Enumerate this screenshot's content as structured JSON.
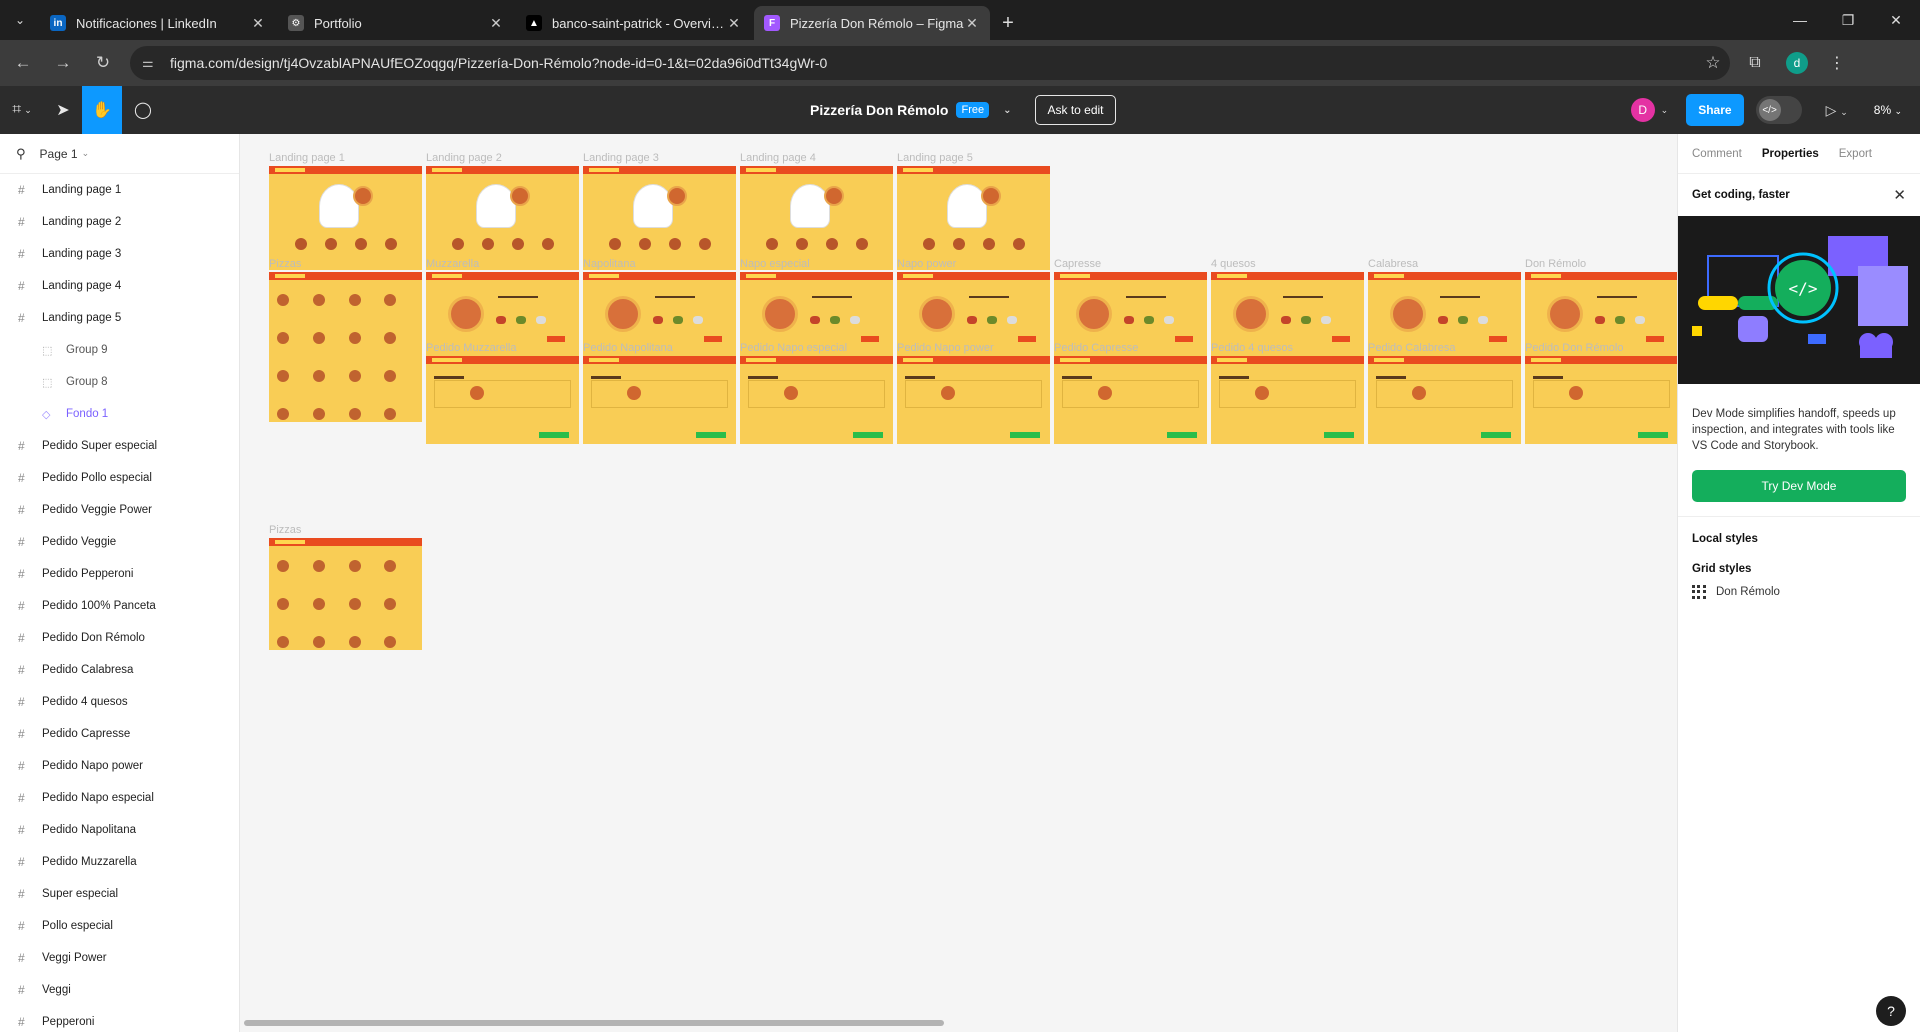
{
  "browser": {
    "tabs": [
      {
        "title": "Notificaciones | LinkedIn",
        "icon": "linkedin-icon",
        "color": "#0a66c2",
        "glyph": "in"
      },
      {
        "title": "Portfolio",
        "icon": "globe-icon",
        "color": "#555555",
        "glyph": "⚙"
      },
      {
        "title": "banco-saint-patrick - Overview",
        "icon": "vercel-icon",
        "color": "#000000",
        "glyph": "▲"
      },
      {
        "title": "Pizzería Don Rémolo – Figma",
        "icon": "figma-icon",
        "color": "#a259ff",
        "glyph": "F"
      }
    ],
    "url": "figma.com/design/tj4OvzablAPNAUfEOZoqgq/Pizzería-Don-Rémolo?node-id=0-1&t=02da96i0dTt34gWr-0",
    "profile_initial": "d"
  },
  "toolbar": {
    "file_name": "Pizzería Don Rémolo",
    "plan_badge": "Free",
    "ask_to_edit": "Ask to edit",
    "avatar_initial": "D",
    "share_label": "Share",
    "zoom": "8%"
  },
  "layers": {
    "page": "Page 1",
    "items": [
      {
        "label": "Landing page 1",
        "kind": "frame"
      },
      {
        "label": "Landing page 2",
        "kind": "frame"
      },
      {
        "label": "Landing page 3",
        "kind": "frame"
      },
      {
        "label": "Landing page 4",
        "kind": "frame"
      },
      {
        "label": "Landing page 5",
        "kind": "frame"
      },
      {
        "label": "Group 9",
        "kind": "group"
      },
      {
        "label": "Group 8",
        "kind": "group"
      },
      {
        "label": "Fondo 1",
        "kind": "component"
      },
      {
        "label": "Pedido Super especial",
        "kind": "frame"
      },
      {
        "label": "Pedido Pollo especial",
        "kind": "frame"
      },
      {
        "label": "Pedido Veggie Power",
        "kind": "frame"
      },
      {
        "label": "Pedido Veggie",
        "kind": "frame"
      },
      {
        "label": "Pedido Pepperoni",
        "kind": "frame"
      },
      {
        "label": "Pedido 100% Panceta",
        "kind": "frame"
      },
      {
        "label": "Pedido Don Rémolo",
        "kind": "frame"
      },
      {
        "label": "Pedido Calabresa",
        "kind": "frame"
      },
      {
        "label": "Pedido 4 quesos",
        "kind": "frame"
      },
      {
        "label": "Pedido Capresse",
        "kind": "frame"
      },
      {
        "label": "Pedido Napo power",
        "kind": "frame"
      },
      {
        "label": "Pedido Napo especial",
        "kind": "frame"
      },
      {
        "label": "Pedido Napolitana",
        "kind": "frame"
      },
      {
        "label": "Pedido Muzzarella",
        "kind": "frame"
      },
      {
        "label": "Super especial",
        "kind": "frame"
      },
      {
        "label": "Pollo especial",
        "kind": "frame"
      },
      {
        "label": "Veggi Power",
        "kind": "frame"
      },
      {
        "label": "Veggi",
        "kind": "frame"
      },
      {
        "label": "Pepperoni",
        "kind": "frame"
      }
    ]
  },
  "canvas": {
    "row1": [
      "Landing page 1",
      "Landing page 2",
      "Landing page 3",
      "Landing page 4",
      "Landing page 5"
    ],
    "row2": [
      "Pizzas",
      "Muzzarella",
      "Napolitana",
      "Napo especial",
      "Napo power",
      "Capresse",
      "4 quesos",
      "Calabresa",
      "Don Rémolo"
    ],
    "row3": [
      "Pedido Muzzarella",
      "Pedido Napolitana",
      "Pedido Napo especial",
      "Pedido Napo power",
      "Pedido Capresse",
      "Pedido 4 quesos",
      "Pedido Calabresa",
      "Pedido Don Rémolo"
    ],
    "row4": [
      "Pizzas"
    ]
  },
  "right_panel": {
    "tabs": [
      "Comment",
      "Properties",
      "Export"
    ],
    "active_tab": "Properties",
    "promo_title": "Get coding, faster",
    "promo_desc": "Dev Mode simplifies handoff, speeds up inspection, and integrates with tools like VS Code and Storybook.",
    "promo_button": "Try Dev Mode",
    "local_styles": "Local styles",
    "grid_styles": "Grid styles",
    "grid_style_item": "Don Rémolo"
  }
}
